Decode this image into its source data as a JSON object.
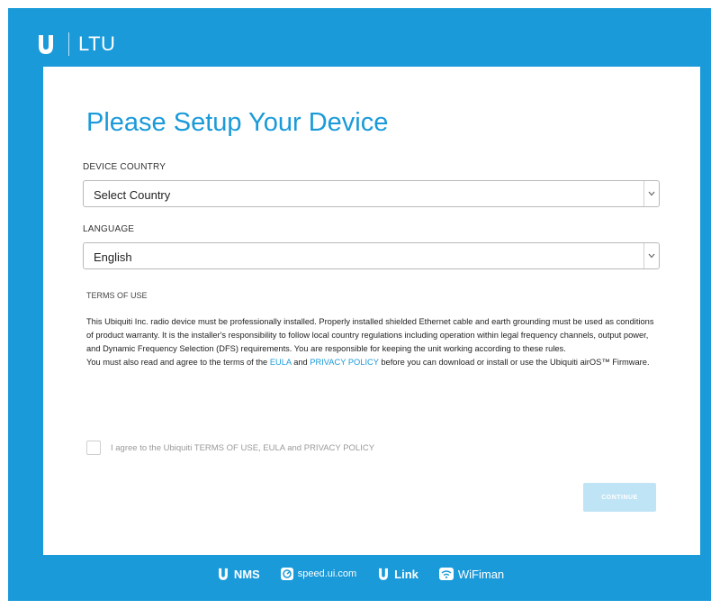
{
  "header": {
    "brand": "LTU"
  },
  "setup": {
    "title": "Please Setup Your Device",
    "country_label": "DEVICE COUNTRY",
    "country_value": "Select Country",
    "language_label": "LANGUAGE",
    "language_value": "English",
    "terms_label": "TERMS OF USE",
    "terms_part1": "This Ubiquiti Inc. radio device must be professionally installed. Properly installed shielded Ethernet cable and earth grounding must be used as conditions of product warranty. It is the installer's responsibility to follow local country regulations including operation within legal frequency channels, output power, and Dynamic Frequency Selection (DFS) requirements. You are responsible for keeping the unit working according to these rules.",
    "terms_part2": "You must also read and agree to the terms of the",
    "eula_link": "EULA",
    "and_text": "and",
    "privacy_link": "PRIVACY POLICY",
    "terms_part3": "before you can download or install or use the Ubiquiti airOS™ Firmware.",
    "agree_label": "I agree to the Ubiquiti TERMS OF USE, EULA and PRIVACY POLICY",
    "continue_label": "CONTINUE"
  },
  "footer": {
    "links": [
      {
        "label": "NMS",
        "icon": "ubiquiti-u-icon"
      },
      {
        "label": "speed.ui.com",
        "icon": "speedometer-icon"
      },
      {
        "label": "Link",
        "icon": "ubiquiti-u-icon"
      },
      {
        "label": "WiFiman",
        "icon": "wifi-icon"
      }
    ]
  },
  "colors": {
    "brand_blue": "#1a9ad9",
    "button_disabled": "#bfe4f5"
  }
}
